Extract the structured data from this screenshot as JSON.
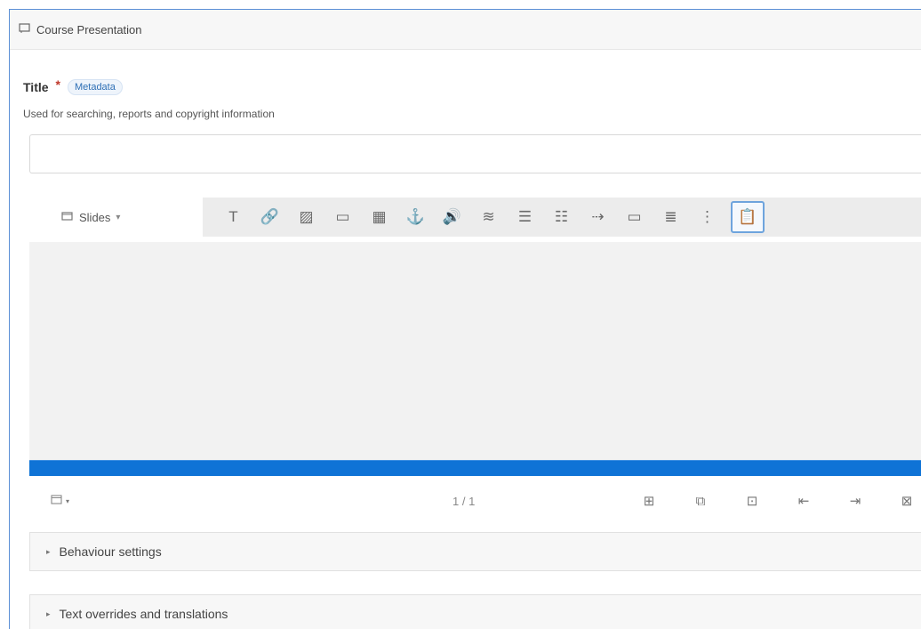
{
  "header": {
    "icon": "slides-icon",
    "label": "Course Presentation"
  },
  "title_field": {
    "label": "Title",
    "required_mark": "*",
    "metadata_label": "Metadata",
    "description": "Used for searching, reports and copyright information",
    "value": ""
  },
  "toolbar": {
    "slides_dropdown": {
      "icon": "slides-icon",
      "label": "Slides",
      "caret": "▾"
    },
    "tools": [
      {
        "name": "text-tool-icon",
        "glyph": "T"
      },
      {
        "name": "link-tool-icon",
        "glyph": "🔗"
      },
      {
        "name": "image-tool-icon",
        "glyph": "▨"
      },
      {
        "name": "shapes-tool-icon",
        "glyph": "▭"
      },
      {
        "name": "video-tool-icon",
        "glyph": "▦"
      },
      {
        "name": "anchor-tool-icon",
        "glyph": "⚓"
      },
      {
        "name": "audio-tool-icon",
        "glyph": "🔊"
      },
      {
        "name": "fill-in-blanks-tool-icon",
        "glyph": "≋"
      },
      {
        "name": "single-choice-tool-icon",
        "glyph": "☰"
      },
      {
        "name": "multiple-choice-tool-icon",
        "glyph": "☷"
      },
      {
        "name": "drag-text-tool-icon",
        "glyph": "⇢"
      },
      {
        "name": "true-false-tool-icon",
        "glyph": "▭"
      },
      {
        "name": "summary-tool-icon",
        "glyph": "≣"
      },
      {
        "name": "more-tools-icon",
        "glyph": "⋮"
      },
      {
        "name": "paste-tool-icon",
        "glyph": "📋"
      }
    ]
  },
  "progress": {
    "fraction": 1.0
  },
  "slide_nav": {
    "layout_icon": "slide-layout-icon",
    "caret": "▾",
    "counter": "1 / 1",
    "tools": [
      {
        "name": "add-slide-icon",
        "glyph": "⊞"
      },
      {
        "name": "clone-slide-icon",
        "glyph": "⧉"
      },
      {
        "name": "background-slide-icon",
        "glyph": "⊡"
      },
      {
        "name": "move-slide-left-icon",
        "glyph": "⇤"
      },
      {
        "name": "move-slide-right-icon",
        "glyph": "⇥"
      },
      {
        "name": "delete-slide-icon",
        "glyph": "⊠"
      }
    ]
  },
  "sections": [
    {
      "label": "Behaviour settings"
    },
    {
      "label": "Text overrides and translations"
    }
  ],
  "colors": {
    "accent": "#0f73d6",
    "frame_border": "#5b8fd6",
    "required": "#c0392b"
  }
}
